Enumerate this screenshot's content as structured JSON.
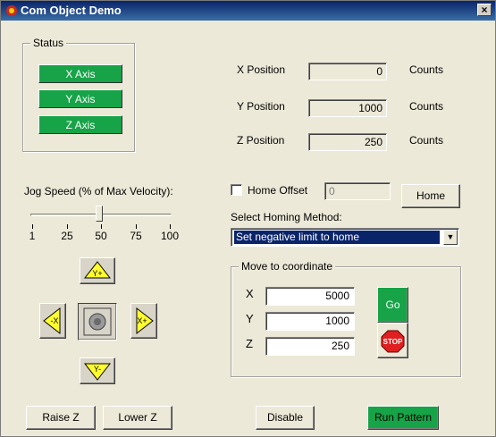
{
  "window": {
    "title": "Com Object Demo",
    "close_label": "×"
  },
  "status": {
    "legend": "Status",
    "buttons": [
      "X Axis",
      "Y Axis",
      "Z Axis"
    ]
  },
  "positions": {
    "x": {
      "label": "X Position",
      "value": "0",
      "unit": "Counts"
    },
    "y": {
      "label": "Y Position",
      "value": "1000",
      "unit": "Counts"
    },
    "z": {
      "label": "Z Position",
      "value": "250",
      "unit": "Counts"
    }
  },
  "jog": {
    "label": "Jog Speed (% of Max Velocity):",
    "ticks": [
      "1",
      "25",
      "50",
      "75",
      "100"
    ],
    "value_percent": 50
  },
  "home": {
    "offset_label": "Home Offset",
    "offset_value": "0",
    "offset_checked": false,
    "button": "Home",
    "method_label": "Select Homing Method:",
    "method_selected": "Set negative limit to home"
  },
  "move": {
    "legend": "Move to coordinate",
    "x_label": "X",
    "x_value": "5000",
    "y_label": "Y",
    "y_value": "1000",
    "z_label": "Z",
    "z_value": "250",
    "go_label": "Go",
    "stop_label": "STOP"
  },
  "jog_buttons": {
    "up": "Y+",
    "down": "Y-",
    "left": "-X",
    "right": "X+"
  },
  "bottom": {
    "raise": "Raise Z",
    "lower": "Lower Z",
    "disable": "Disable",
    "run": "Run Pattern"
  },
  "colors": {
    "green": "#17a347",
    "yellow": "#ffff30",
    "titlebar": "#0a246a"
  }
}
